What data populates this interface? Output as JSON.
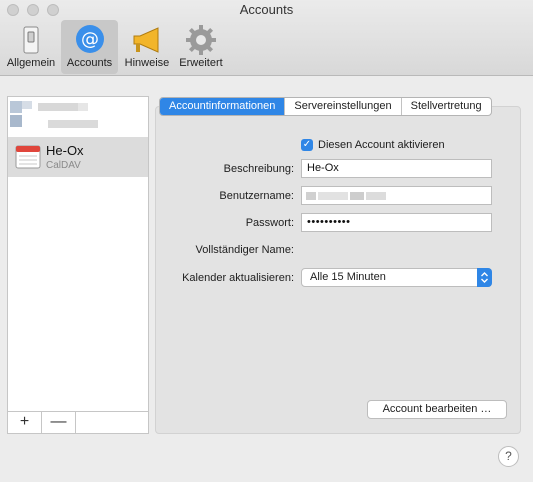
{
  "window": {
    "title": "Accounts"
  },
  "toolbar": {
    "items": [
      {
        "label": "Allgemein",
        "icon": "switch-icon"
      },
      {
        "label": "Accounts",
        "icon": "at-sign-icon",
        "selected": true
      },
      {
        "label": "Hinweise",
        "icon": "megaphone-icon"
      },
      {
        "label": "Erweitert",
        "icon": "gear-icon"
      }
    ]
  },
  "sidebar": {
    "accounts": [
      {
        "name": "",
        "type": "",
        "blurred": true
      },
      {
        "name": "He-Ox",
        "type": "CalDAV",
        "selected": true
      }
    ],
    "add_label": "+",
    "remove_label": "—"
  },
  "tabs": [
    {
      "label": "Accountinformationen",
      "active": true
    },
    {
      "label": "Servereinstellungen"
    },
    {
      "label": "Stellvertretung"
    }
  ],
  "form": {
    "enable_label": "Diesen Account aktivieren",
    "enable_checked": true,
    "description_label": "Beschreibung:",
    "description_value": "He-Ox",
    "username_label": "Benutzername:",
    "password_label": "Passwort:",
    "password_value": "••••••••••",
    "fullname_label": "Vollständiger Name:",
    "refresh_label": "Kalender aktualisieren:",
    "refresh_value": "Alle 15 Minuten"
  },
  "buttons": {
    "edit_account": "Account bearbeiten …",
    "help": "?"
  },
  "colors": {
    "accent": "#2f86e6",
    "window_bg": "#ececec"
  }
}
